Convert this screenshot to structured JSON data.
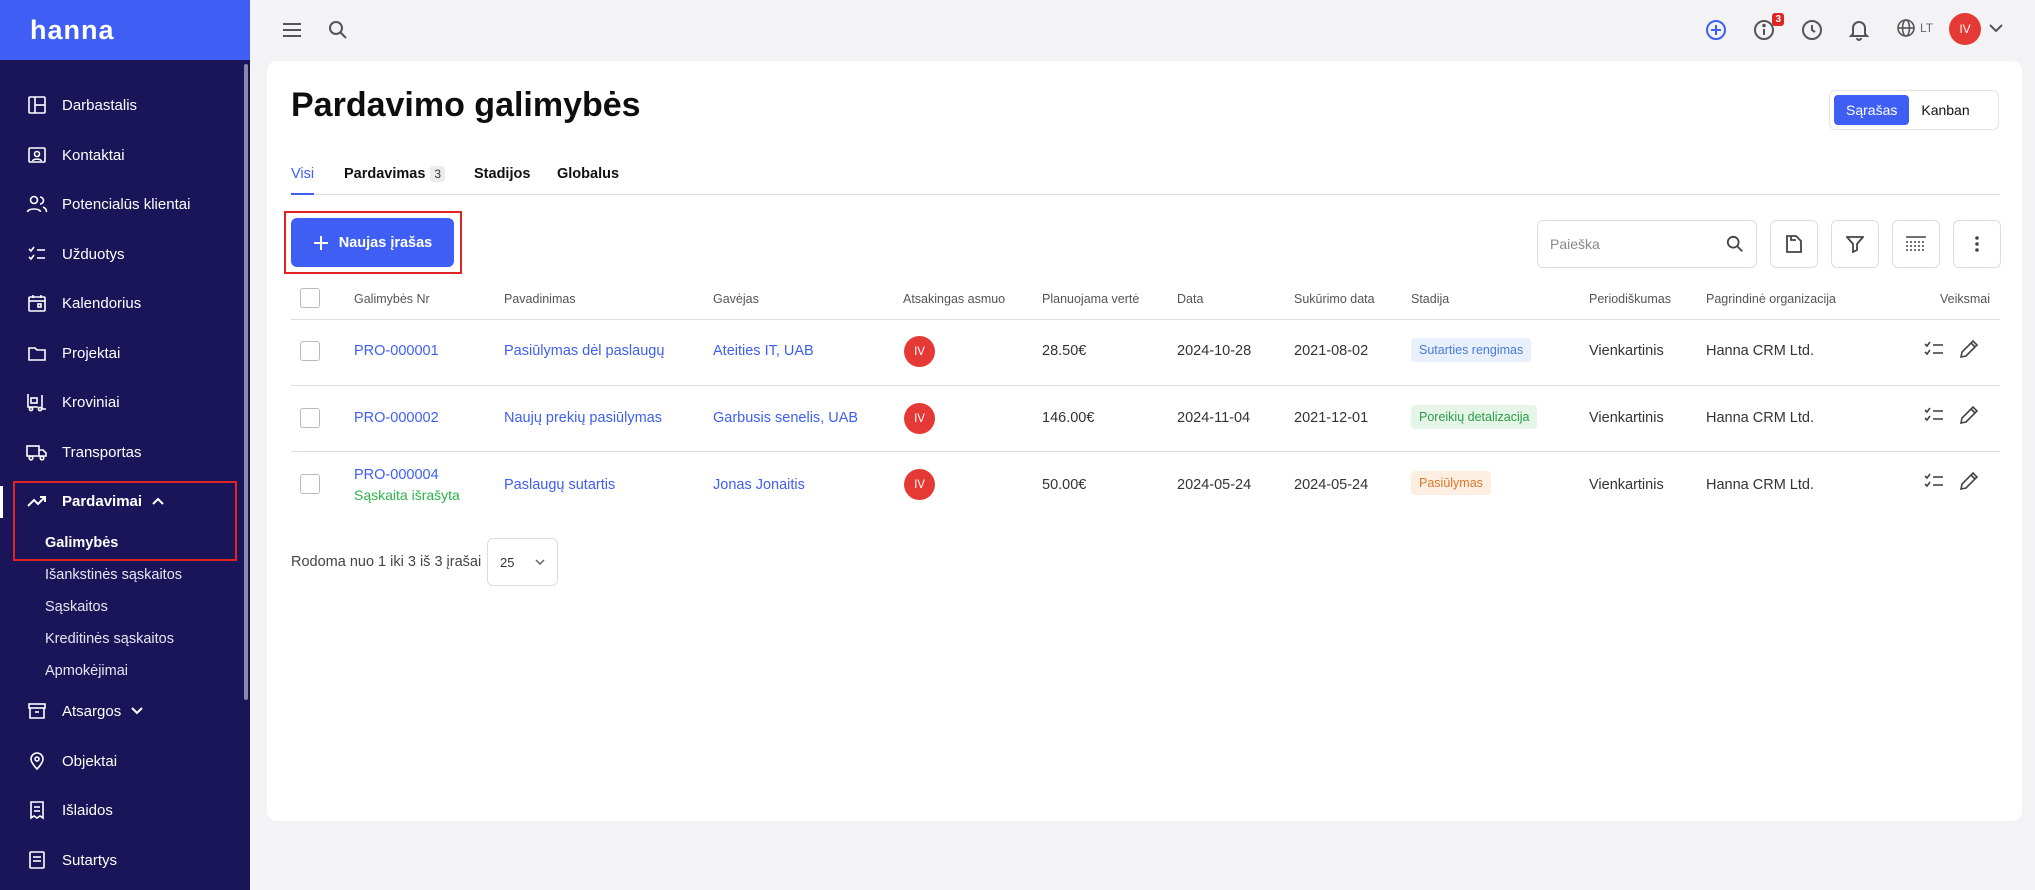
{
  "app": {
    "logo": "hanna"
  },
  "sidebar": {
    "items": [
      {
        "label": "Darbastalis",
        "icon": "dashboard-icon"
      },
      {
        "label": "Kontaktai",
        "icon": "contact-card-icon"
      },
      {
        "label": "Potencialūs klientai",
        "icon": "users-icon"
      },
      {
        "label": "Užduotys",
        "icon": "checklist-icon"
      },
      {
        "label": "Kalendorius",
        "icon": "calendar-icon"
      },
      {
        "label": "Projektai",
        "icon": "folder-icon"
      },
      {
        "label": "Kroviniai",
        "icon": "forklift-icon"
      },
      {
        "label": "Transportas",
        "icon": "truck-icon"
      },
      {
        "label": "Pardavimai",
        "icon": "trending-up-icon",
        "expanded": true
      },
      {
        "label": "Atsargos",
        "icon": "archive-box-icon"
      },
      {
        "label": "Objektai",
        "icon": "map-pin-icon"
      },
      {
        "label": "Išlaidos",
        "icon": "receipt-icon"
      },
      {
        "label": "Sutartys",
        "icon": "document-icon"
      }
    ],
    "sales_sub": [
      {
        "label": "Galimybės",
        "active": true
      },
      {
        "label": "Išankstinės sąskaitos"
      },
      {
        "label": "Sąskaitos"
      },
      {
        "label": "Kreditinės sąskaitos"
      },
      {
        "label": "Apmokėjimai"
      }
    ]
  },
  "topbar": {
    "notifications_badge": "3",
    "language": "LT",
    "user_initials": "IV"
  },
  "page": {
    "title": "Pardavimo galimybės",
    "view_toggle": {
      "list": "Sąrašas",
      "kanban": "Kanban",
      "selected": "list"
    },
    "tabs": [
      {
        "label": "Visi",
        "active": true
      },
      {
        "label": "Pardavimas",
        "count": "3"
      },
      {
        "label": "Stadijos"
      },
      {
        "label": "Globalus"
      }
    ],
    "add_button": "Naujas įrašas",
    "search": {
      "placeholder": "Paieška"
    }
  },
  "table": {
    "columns": [
      "Galimybės Nr",
      "Pavadinimas",
      "Gavėjas",
      "Atsakingas asmuo",
      "Planuojama vertė",
      "Data",
      "Sukūrimo data",
      "Stadija",
      "Periodiškumas",
      "Pagrindinė organizacija",
      "Veiksmai"
    ],
    "rows": [
      {
        "nr": "PRO-000001",
        "nr_sub": "",
        "title": "Pasiūlymas dėl paslaugų",
        "recipient": "Ateities IT, UAB",
        "person": "IV",
        "value": "28.50€",
        "date": "2024-10-28",
        "created": "2021-08-02",
        "stage": "Sutarties rengimas",
        "stage_color": "#e8f0fd",
        "stage_text": "#4a79d8",
        "period": "Vienkartinis",
        "org": "Hanna CRM Ltd."
      },
      {
        "nr": "PRO-000002",
        "nr_sub": "",
        "title": "Naujų prekių pasiūlymas",
        "recipient": "Garbusis senelis, UAB",
        "person": "IV",
        "value": "146.00€",
        "date": "2024-11-04",
        "created": "2021-12-01",
        "stage": "Poreikių detalizacija",
        "stage_color": "#e5f6e9",
        "stage_text": "#2c9a47",
        "period": "Vienkartinis",
        "org": "Hanna CRM Ltd."
      },
      {
        "nr": "PRO-000004",
        "nr_sub": "Sąskaita išrašyta",
        "title": "Paslaugų sutartis",
        "recipient": "Jonas Jonaitis",
        "person": "IV",
        "value": "50.00€",
        "date": "2024-05-24",
        "created": "2024-05-24",
        "stage": "Pasiūlymas",
        "stage_color": "#fdeee2",
        "stage_text": "#d9782f",
        "period": "Vienkartinis",
        "org": "Hanna CRM Ltd."
      }
    ]
  },
  "footer": {
    "summary": "Rodoma nuo 1 iki 3 iš 3 įrašai",
    "per_page": "25"
  }
}
